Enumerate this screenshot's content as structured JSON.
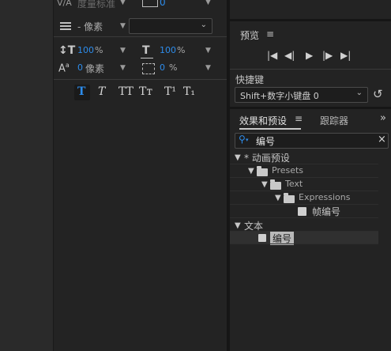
{
  "character": {
    "leading_label": "度量标准",
    "tracking_value": "0",
    "stroke_unit": "- 像素",
    "vert_scale_value": "100",
    "vert_scale_unit": "%",
    "horiz_scale_value": "100",
    "horiz_scale_unit": "%",
    "baseline_value": "0",
    "baseline_unit": "像素",
    "tsume_value": "0",
    "tsume_unit": "%",
    "style_buttons": [
      "T",
      "T",
      "TT",
      "Tт",
      "T¹",
      "T₁"
    ]
  },
  "preview": {
    "title": "预览",
    "menu_icon": "hamburger-icon"
  },
  "shortcut": {
    "label": "快捷键",
    "selected": "Shift+数字小键盘 0"
  },
  "effects": {
    "tab_effects": "效果和预设",
    "tab_tracker": "跟踪器",
    "search_value": "编号",
    "tree": [
      {
        "label": "* 动画预设"
      },
      {
        "label": "Presets"
      },
      {
        "label": "Text"
      },
      {
        "label": "Expressions"
      },
      {
        "label": "帧编号"
      },
      {
        "label": "文本"
      },
      {
        "label": "编号"
      }
    ]
  }
}
